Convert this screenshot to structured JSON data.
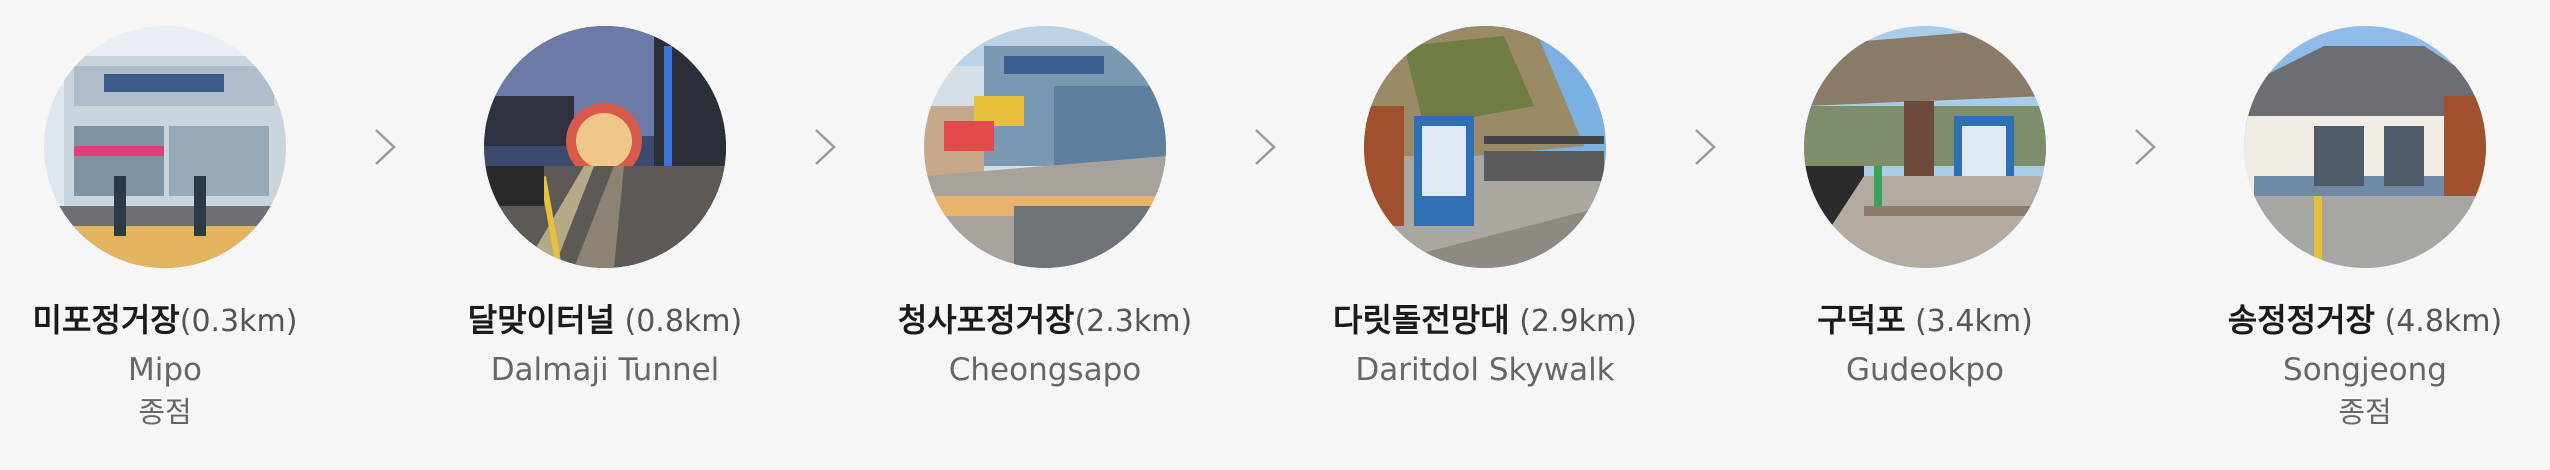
{
  "stations": [
    {
      "name": "미포정거장",
      "distance": "(0.3km)",
      "english": "Mipo",
      "terminus": "종점"
    },
    {
      "name": "달맞이터널",
      "distance": " (0.8km)",
      "english": "Dalmaji Tunnel",
      "terminus": ""
    },
    {
      "name": "청사포정거장",
      "distance": "(2.3km)",
      "english": "Cheongsapo",
      "terminus": ""
    },
    {
      "name": "다릿돌전망대",
      "distance": " (2.9km)",
      "english": "Daritdol Skywalk",
      "terminus": ""
    },
    {
      "name": "구덕포",
      "distance": " (3.4km)",
      "english": "Gudeokpo",
      "terminus": ""
    },
    {
      "name": "송정정거장",
      "distance": " (4.8km)",
      "english": "Songjeong",
      "terminus": "종점"
    }
  ],
  "icons": {
    "arrow": "chevron-right-icon"
  }
}
